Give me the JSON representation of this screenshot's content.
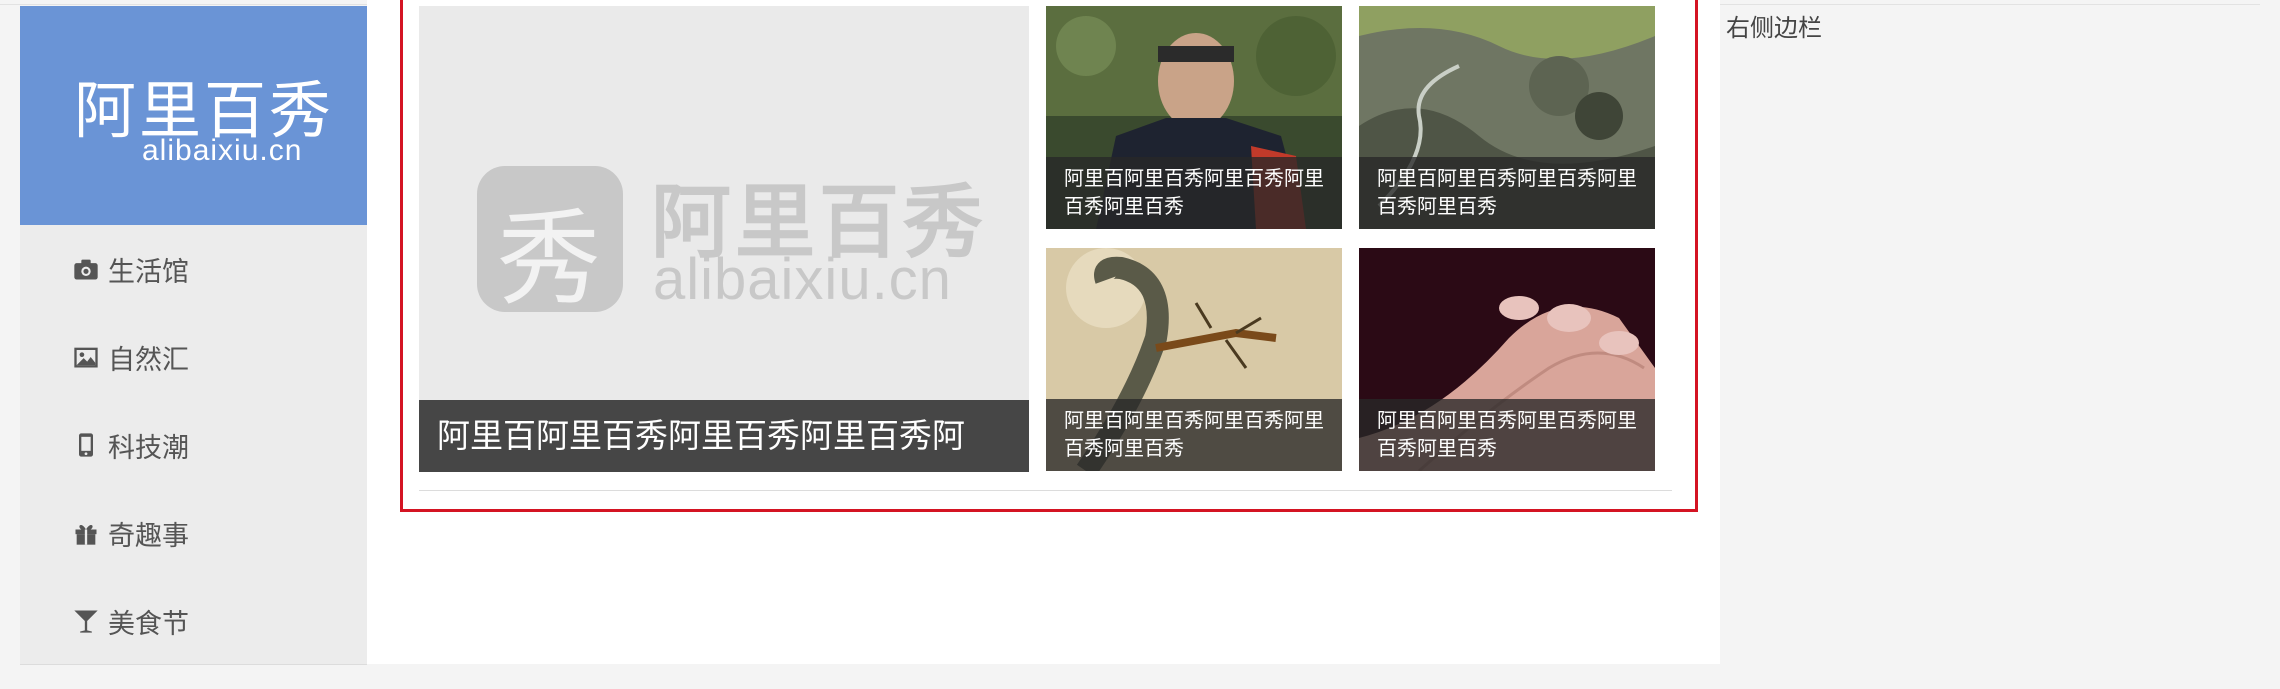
{
  "brand": {
    "name_cn": "阿里百秀",
    "name_en": "alibaixiu.cn"
  },
  "nav": {
    "items": [
      {
        "label": "生活馆",
        "icon": "camera-icon"
      },
      {
        "label": "自然汇",
        "icon": "image-icon"
      },
      {
        "label": "科技潮",
        "icon": "phone-icon"
      },
      {
        "label": "奇趣事",
        "icon": "gift-icon"
      },
      {
        "label": "美食节",
        "icon": "glass-icon"
      }
    ]
  },
  "featured": {
    "big": {
      "caption": "阿里百阿里百秀阿里百秀阿里百秀阿",
      "watermark_cn": "阿里百秀",
      "watermark_en": "alibaixiu.cn",
      "watermark_icon": "秀"
    },
    "tiles": [
      {
        "caption": "阿里百阿里百秀阿里百秀阿里百秀阿里百秀",
        "image": "man-portrait-photo"
      },
      {
        "caption": "阿里百阿里百秀阿里百秀阿里百秀阿里百秀",
        "image": "aerial-landscape-photo"
      },
      {
        "caption": "阿里百阿里百秀阿里百秀阿里百秀阿里百秀",
        "image": "snake-photo"
      },
      {
        "caption": "阿里百阿里百秀阿里百秀阿里百秀阿里百秀",
        "image": "fingers-photo"
      }
    ]
  },
  "right_sidebar": {
    "label": "右侧边栏"
  },
  "colors": {
    "brand_blue": "#6a94d6",
    "highlight_red": "#d41423"
  }
}
